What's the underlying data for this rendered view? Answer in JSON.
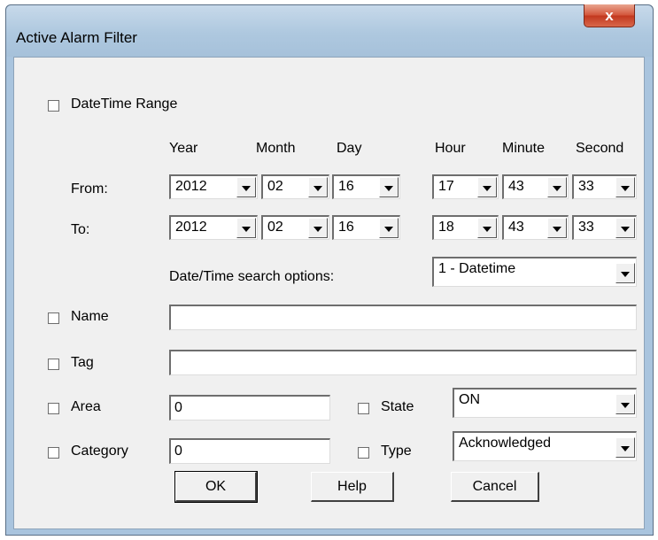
{
  "window": {
    "title": "Active Alarm Filter",
    "close_glyph": "x"
  },
  "datetime": {
    "checkbox_label": "DateTime Range",
    "headers": {
      "year": "Year",
      "month": "Month",
      "day": "Day",
      "hour": "Hour",
      "minute": "Minute",
      "second": "Second"
    },
    "from": {
      "label": "From:",
      "year": "2012",
      "month": "02",
      "day": "16",
      "hour": "17",
      "minute": "43",
      "second": "33"
    },
    "to": {
      "label": "To:",
      "year": "2012",
      "month": "02",
      "day": "16",
      "hour": "18",
      "minute": "43",
      "second": "33"
    },
    "search_options_label": "Date/Time search options:",
    "search_options_value": "1 - Datetime"
  },
  "filters": {
    "name": {
      "label": "Name",
      "value": ""
    },
    "tag": {
      "label": "Tag",
      "value": ""
    },
    "area": {
      "label": "Area",
      "value": "0"
    },
    "category": {
      "label": "Category",
      "value": "0"
    },
    "state": {
      "label": "State",
      "value": "ON"
    },
    "type": {
      "label": "Type",
      "value": "Acknowledged"
    }
  },
  "buttons": {
    "ok": "OK",
    "help": "Help",
    "cancel": "Cancel"
  }
}
